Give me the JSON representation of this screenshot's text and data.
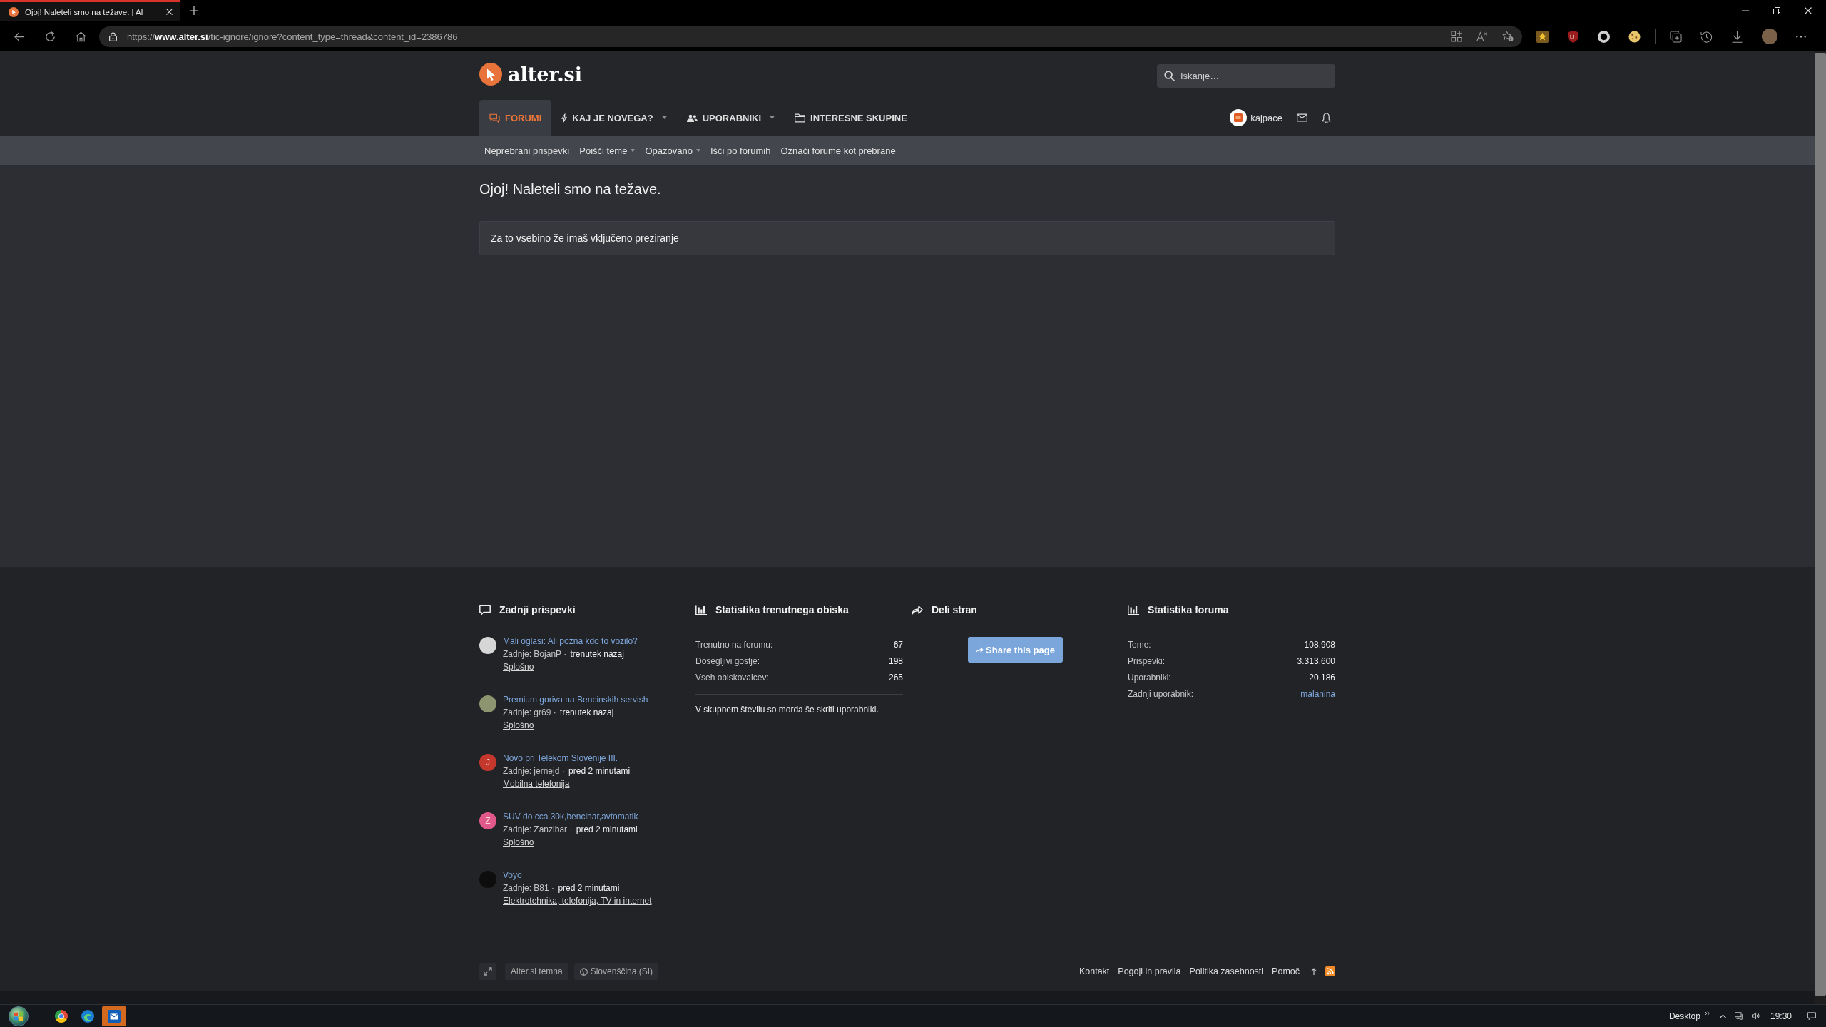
{
  "browser": {
    "tab": {
      "title": "Ojoj! Naleteli smo na težave. | Al",
      "selected": true
    },
    "address": "https://**www.alter.si**/tic-ignore/ignore?content_type=thread&content_id=2386786"
  },
  "header": {
    "logo": "alter.si",
    "search": {
      "placeholder": "Iskanje…"
    }
  },
  "nav": {
    "tabs": [
      {
        "label": "FORUMI",
        "kind": "forums",
        "selected": true,
        "dropdown": false
      },
      {
        "label": "KAJ JE NOVEGA?",
        "kind": "whats_new",
        "selected": false,
        "dropdown": true
      },
      {
        "label": "UPORABNIKI",
        "kind": "members",
        "selected": false,
        "dropdown": true
      },
      {
        "label": "INTERESNE SKUPINE",
        "kind": "groups",
        "selected": false,
        "dropdown": false
      }
    ],
    "user": {
      "name": "kajpace"
    }
  },
  "subnav": [
    {
      "label": "Neprebrani prispevki",
      "dropdown": false
    },
    {
      "label": "Poišči teme",
      "dropdown": true
    },
    {
      "label": "Opazovano",
      "dropdown": true
    },
    {
      "label": "Išči po forumih",
      "dropdown": false
    },
    {
      "label": "Označi forume kot prebrane",
      "dropdown": false
    }
  ],
  "page": {
    "title": "Ojoj! Naleteli smo na težave.",
    "message": "Za to vsebino že imaš vključeno preziranje"
  },
  "footer": {
    "recent_posts": {
      "heading": "Zadnji prispevki",
      "items": [
        {
          "title": "Mali oglasi: Ali pozna kdo to vozilo?",
          "byline": "Zadnje: BojanP ·",
          "time": "trenutek nazaj",
          "forum": "Splošno",
          "avatar": {
            "kind": "photo",
            "color": "#d6d6d6"
          }
        },
        {
          "title": "Premium goriva na Bencinskih servish",
          "byline": "Zadnje: gr69 ·",
          "time": "trenutek nazaj",
          "forum": "Splošno",
          "avatar": {
            "kind": "photo",
            "color": "#8c9470"
          }
        },
        {
          "title": "Novo pri Telekom Slovenije III.",
          "byline": "Zadnje: jernejd ·",
          "time": "pred 2 minutami",
          "forum": "Mobilna telefonija",
          "avatar": {
            "kind": "letter",
            "letter": "J",
            "color": "#c4372c"
          }
        },
        {
          "title": "SUV do cca 30k,bencinar,avtomatik",
          "byline": "Zadnje: Zanzibar ·",
          "time": "pred 2 minutami",
          "forum": "Splošno",
          "avatar": {
            "kind": "letter",
            "letter": "Z",
            "color": "#e0598a"
          }
        },
        {
          "title": "Voyo",
          "byline": "Zadnje: B81 ·",
          "time": "pred 2 minutami",
          "forum": "Elektrotehnika, telefonija, TV in internet",
          "avatar": {
            "kind": "photo",
            "color": "#0d0d0d"
          }
        }
      ]
    },
    "online_stats": {
      "heading": "Statistika trenutnega obiska",
      "rows": [
        {
          "label": "Trenutno na forumu:",
          "value": "67",
          "kind": "number"
        },
        {
          "label": "Dosegljivi gostje:",
          "value": "198",
          "kind": "number"
        },
        {
          "label": "Vseh obiskovalcev:",
          "value": "265",
          "kind": "number"
        }
      ],
      "note": "V skupnem številu so morda še skriti uporabniki."
    },
    "share": {
      "heading": "Deli stran",
      "button": "Share this page"
    },
    "forum_stats": {
      "heading": "Statistika foruma",
      "rows": [
        {
          "label": "Teme:",
          "value": "108.908",
          "kind": "number"
        },
        {
          "label": "Prispevki:",
          "value": "3.313.600",
          "kind": "number"
        },
        {
          "label": "Uporabniki:",
          "value": "20.186",
          "kind": "number"
        },
        {
          "label": "Zadnji uporabnik:",
          "value": "malanina",
          "kind": "link"
        }
      ]
    },
    "bottom": {
      "style": "Alter.si temna",
      "language": "Slovenščina (SI)",
      "links": [
        "Kontakt",
        "Pogoji in pravila",
        "Politika zasebnosti",
        "Pomoč"
      ]
    }
  },
  "taskbar": {
    "apps": [
      {
        "kind": "ring",
        "highlighted": false
      },
      {
        "kind": "wave",
        "highlighted": false
      },
      {
        "kind": "mail",
        "highlighted": true
      }
    ],
    "toolbar": "Desktop",
    "clock": "19:30"
  }
}
